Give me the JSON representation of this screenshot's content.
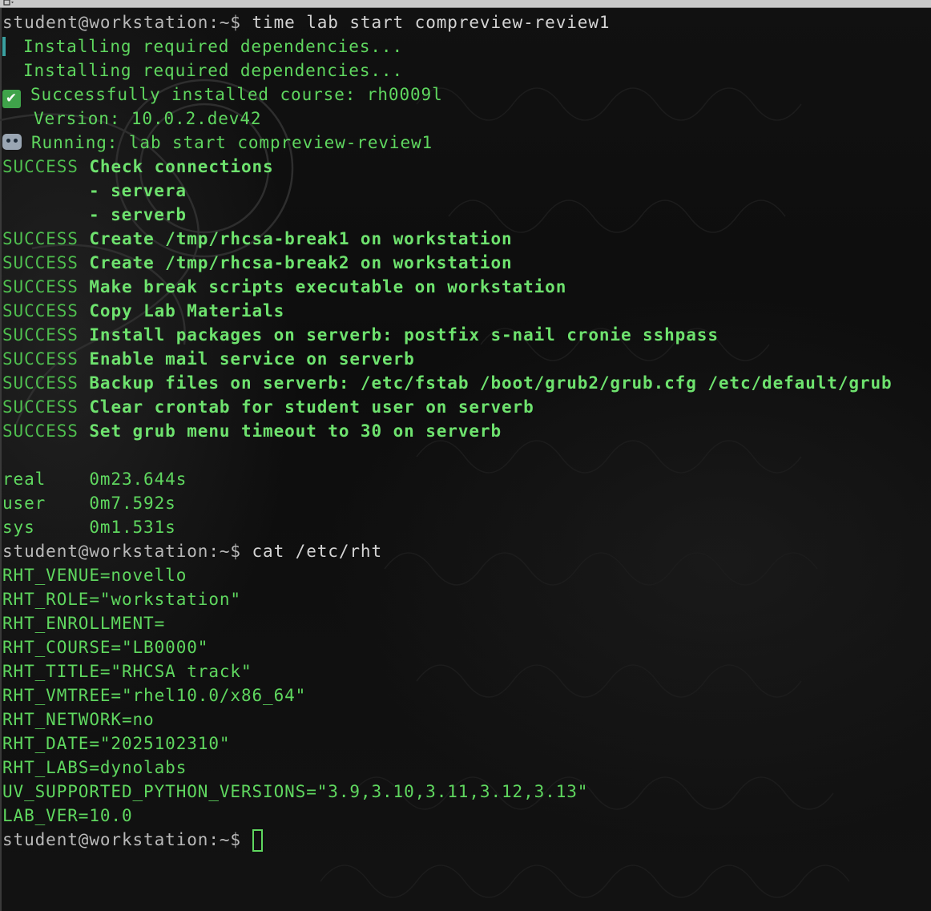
{
  "terminal": {
    "prompt": "student@workstation:~$ ",
    "lines": [
      {
        "type": "command",
        "text": "time lab start compreview-review1"
      },
      {
        "type": "spinner",
        "text": "Installing required dependencies..."
      },
      {
        "type": "indent",
        "text": "Installing required dependencies..."
      },
      {
        "type": "check",
        "icon": "check-mark-icon",
        "text": "Successfully installed course: rh0009l"
      },
      {
        "type": "indent2",
        "text": "Version: 10.0.2.dev42"
      },
      {
        "type": "robot",
        "icon": "robot-icon",
        "text": "Running: lab start compreview-review1"
      },
      {
        "type": "success",
        "status": "SUCCESS",
        "text": "Check connections"
      },
      {
        "type": "sub",
        "text": "- servera"
      },
      {
        "type": "sub",
        "text": "- serverb"
      },
      {
        "type": "success",
        "status": "SUCCESS",
        "text": "Create /tmp/rhcsa-break1 on workstation"
      },
      {
        "type": "success",
        "status": "SUCCESS",
        "text": "Create /tmp/rhcsa-break2 on workstation"
      },
      {
        "type": "success",
        "status": "SUCCESS",
        "text": "Make break scripts executable on workstation"
      },
      {
        "type": "success",
        "status": "SUCCESS",
        "text": "Copy Lab Materials"
      },
      {
        "type": "success",
        "status": "SUCCESS",
        "text": "Install packages on serverb: postfix s-nail cronie sshpass"
      },
      {
        "type": "success",
        "status": "SUCCESS",
        "text": "Enable mail service on serverb"
      },
      {
        "type": "success",
        "status": "SUCCESS",
        "text": "Backup files on serverb: /etc/fstab /boot/grub2/grub.cfg /etc/default/grub"
      },
      {
        "type": "success",
        "status": "SUCCESS",
        "text": "Clear crontab for student user on serverb"
      },
      {
        "type": "success",
        "status": "SUCCESS",
        "text": "Set grub menu timeout to 30 on serverb"
      },
      {
        "type": "blank",
        "text": ""
      },
      {
        "type": "plain",
        "text": "real    0m23.644s"
      },
      {
        "type": "plain",
        "text": "user    0m7.592s"
      },
      {
        "type": "plain",
        "text": "sys     0m1.531s"
      },
      {
        "type": "command",
        "text": "cat /etc/rht"
      },
      {
        "type": "plain",
        "text": "RHT_VENUE=novello"
      },
      {
        "type": "plain",
        "text": "RHT_ROLE=\"workstation\""
      },
      {
        "type": "plain",
        "text": "RHT_ENROLLMENT="
      },
      {
        "type": "plain",
        "text": "RHT_COURSE=\"LB0000\""
      },
      {
        "type": "plain",
        "text": "RHT_TITLE=\"RHCSA track\""
      },
      {
        "type": "plain",
        "text": "RHT_VMTREE=\"rhel10.0/x86_64\""
      },
      {
        "type": "plain",
        "text": "RHT_NETWORK=no"
      },
      {
        "type": "plain",
        "text": "RHT_DATE=\"2025102310\""
      },
      {
        "type": "plain",
        "text": "RHT_LABS=dynolabs"
      },
      {
        "type": "plain",
        "text": "UV_SUPPORTED_PYTHON_VERSIONS=\"3.9,3.10,3.11,3.12,3.13\""
      },
      {
        "type": "plain",
        "text": "LAB_VER=10.0"
      },
      {
        "type": "input",
        "text": ""
      }
    ]
  },
  "colors": {
    "output_green": "#5fd75f",
    "prompt_gray": "#b9b9b9",
    "background": "#0d0d0d"
  }
}
